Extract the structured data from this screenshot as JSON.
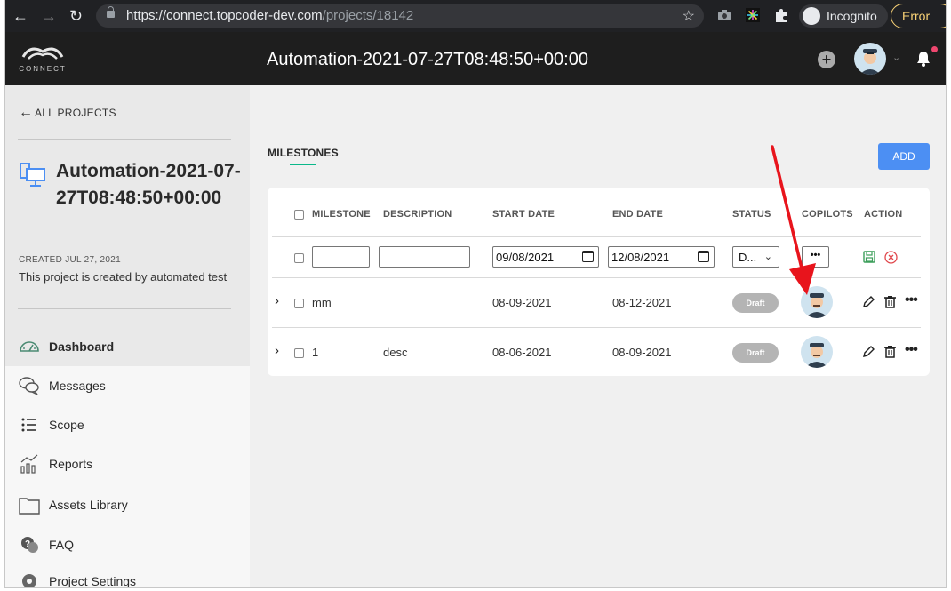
{
  "browser": {
    "url_host": "https://connect.topcoder-dev.com",
    "url_path": "/projects/18142",
    "incognito_label": "Incognito",
    "error_label": "Error"
  },
  "header": {
    "logo_text": "CONNECT",
    "title": "Automation-2021-07-27T08:48:50+00:00"
  },
  "sidebar": {
    "back_label": "ALL PROJECTS",
    "project_name": "Automation-2021-07-27T08:48:50+00:00",
    "created": "CREATED JUL 27, 2021",
    "description": "This project is created by automated test",
    "menu": [
      {
        "label": "Dashboard",
        "icon": "dashboard-icon",
        "active": true
      },
      {
        "label": "Messages",
        "icon": "messages-icon"
      },
      {
        "label": "Scope",
        "icon": "scope-list-icon"
      },
      {
        "label": "Reports",
        "icon": "reports-chart-icon"
      },
      {
        "label": "Assets Library",
        "icon": "folder-icon"
      },
      {
        "label": "FAQ",
        "icon": "faq-icon"
      },
      {
        "label": "Project Settings",
        "icon": "gear-icon"
      }
    ]
  },
  "main": {
    "tab": "MILESTONES",
    "add_label": "ADD",
    "columns": [
      "MILESTONE",
      "DESCRIPTION",
      "START DATE",
      "END DATE",
      "STATUS",
      "COPILOTS",
      "ACTION"
    ],
    "new_row": {
      "milestone": "",
      "description": "",
      "start_date": "09/08/2021",
      "end_date": "12/08/2021",
      "status": "D...",
      "copilots_button": "•••"
    },
    "rows": [
      {
        "milestone": "mm",
        "description": "",
        "start": "08-09-2021",
        "end": "08-12-2021",
        "status": "Draft"
      },
      {
        "milestone": "1",
        "description": "desc",
        "start": "08-06-2021",
        "end": "08-09-2021",
        "status": "Draft"
      }
    ],
    "more_glyph": "•••"
  },
  "colors": {
    "header_bg": "#1e1e1e",
    "accent_blue": "#4c8ff3",
    "tab_underline": "#0ab88a",
    "draft_badge": "#b4b4b4",
    "annotation_arrow": "#e8141c"
  }
}
